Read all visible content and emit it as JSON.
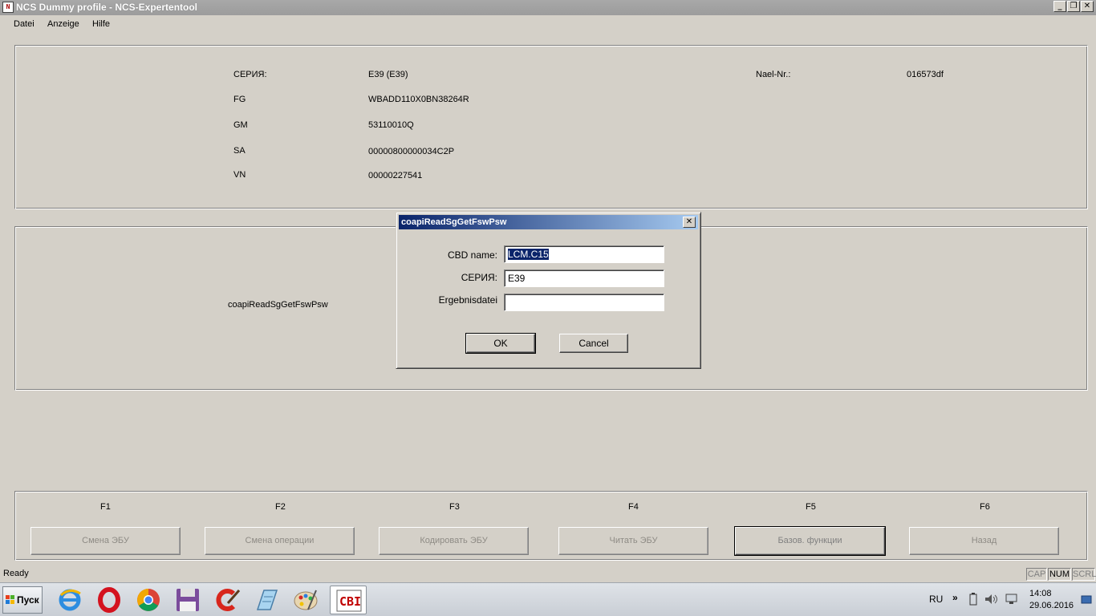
{
  "window": {
    "title": "NCS Dummy profile - NCS-Expertentool",
    "minimize": "_",
    "maximize": "❐",
    "close": "✕"
  },
  "menu": [
    "Datei",
    "Anzeige",
    "Hilfe"
  ],
  "vehicle_info": {
    "series_label": "СЕРИЯ:",
    "series_value": "E39 (E39)",
    "fg_label": "FG",
    "fg_value": "WBADD110X0BN38264R",
    "gm_label": "GM",
    "gm_value": "53110010Q",
    "sa_label": "SA",
    "sa_value": "00000800000034C2P",
    "vn_label": "VN",
    "vn_value": "00000227541",
    "nael_label": "Nael-Nr.:",
    "nael_value": "016573df"
  },
  "job_panel": {
    "job_name": "coapiReadSgGetFswPsw"
  },
  "dialog": {
    "title": "coapiReadSgGetFswPsw",
    "close": "✕",
    "cbd_label": "CBD name:",
    "cbd_value": "LCM.C15",
    "series_label": "СЕРИЯ:",
    "series_value": "E39",
    "result_label": "Ergebnisdatei",
    "result_value": "",
    "ok": "OK",
    "cancel": "Cancel"
  },
  "function_keys": [
    {
      "key": "F1",
      "label": "Смена ЭБУ"
    },
    {
      "key": "F2",
      "label": "Смена операции"
    },
    {
      "key": "F3",
      "label": "Кодировать ЭБУ"
    },
    {
      "key": "F4",
      "label": "Читать ЭБУ"
    },
    {
      "key": "F5",
      "label": "Базов. функции"
    },
    {
      "key": "F6",
      "label": "Назад"
    }
  ],
  "status": {
    "text": "Ready",
    "cap": "CAP",
    "num": "NUM",
    "scrl": "SCRL"
  },
  "taskbar": {
    "start_label": "Пуск",
    "apps": [
      "internet-explorer-icon",
      "opera-icon",
      "chrome-icon",
      "save-disk-icon",
      "ccleaner-icon",
      "notepad-icon",
      "paint-icon",
      "ncs-expert-icon"
    ],
    "ncs_icon_text": "CBI",
    "language": "RU",
    "tray_arrow": "»",
    "time": "14:08",
    "date": "29.06.2016"
  }
}
